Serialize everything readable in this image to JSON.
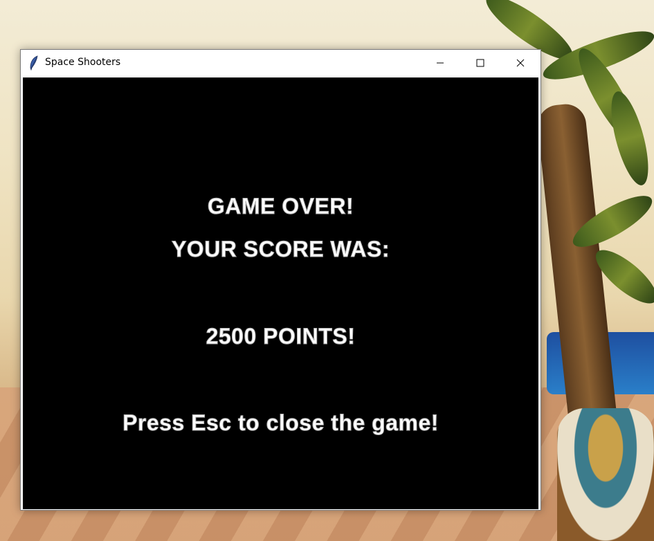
{
  "window": {
    "title": "Space Shooters",
    "icon": "feather-icon",
    "controls": {
      "minimize": "minimize-icon",
      "maximize": "maximize-icon",
      "close": "close-icon"
    }
  },
  "game": {
    "game_over": "GAME OVER!",
    "score_label": "YOUR SCORE WAS:",
    "points": "2500 POINTS!",
    "instruction": "Press Esc to close the game!",
    "background_color": "#000000",
    "text_color": "#ffffff"
  }
}
